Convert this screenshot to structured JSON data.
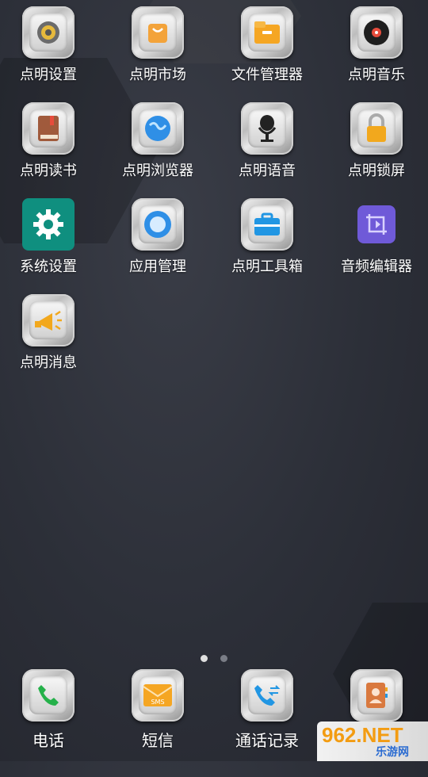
{
  "apps": [
    {
      "label": "点明设置",
      "icon": "gear-gold-icon"
    },
    {
      "label": "点明市场",
      "icon": "shopping-bag-icon"
    },
    {
      "label": "文件管理器",
      "icon": "folder-icon"
    },
    {
      "label": "点明音乐",
      "icon": "vinyl-record-icon"
    },
    {
      "label": "点明读书",
      "icon": "book-icon"
    },
    {
      "label": "点明浏览器",
      "icon": "globe-icon"
    },
    {
      "label": "点明语音",
      "icon": "microphone-icon"
    },
    {
      "label": "点明锁屏",
      "icon": "padlock-icon"
    },
    {
      "label": "系统设置",
      "icon": "settings-gear-icon"
    },
    {
      "label": "应用管理",
      "icon": "app-manager-icon"
    },
    {
      "label": "点明工具箱",
      "icon": "toolbox-icon"
    },
    {
      "label": "音频编辑器",
      "icon": "crop-icon"
    },
    {
      "label": "点明消息",
      "icon": "megaphone-icon"
    }
  ],
  "dock": [
    {
      "label": "电话",
      "icon": "phone-icon"
    },
    {
      "label": "短信",
      "icon": "sms-icon"
    },
    {
      "label": "通话记录",
      "icon": "call-log-icon"
    },
    {
      "label": "",
      "icon": "contacts-icon"
    }
  ],
  "page_indicator": {
    "pages": 2,
    "current": 1
  },
  "watermark": {
    "brand": "962.NET",
    "sub": "乐游网"
  },
  "colors": {
    "accent_green": "#0f8f7f",
    "label": "#ffffff",
    "dot_active": "#e0e0e0",
    "dot_inactive": "#7a7d86"
  }
}
